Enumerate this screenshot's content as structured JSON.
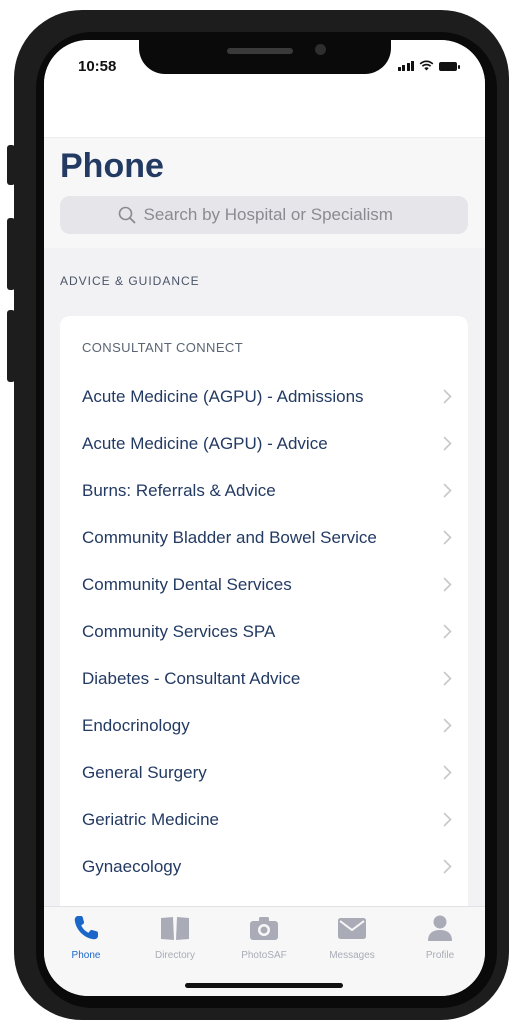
{
  "status_bar": {
    "time": "10:58"
  },
  "page": {
    "title": "Phone"
  },
  "search": {
    "placeholder": "Search by Hospital or Specialism"
  },
  "section": {
    "label": "ADVICE & GUIDANCE"
  },
  "card": {
    "heading": "CONSULTANT CONNECT",
    "items": [
      {
        "label": "Acute Medicine (AGPU) - Admissions"
      },
      {
        "label": "Acute Medicine (AGPU) - Advice"
      },
      {
        "label": "Burns: Referrals & Advice"
      },
      {
        "label": "Community Bladder and Bowel Service"
      },
      {
        "label": "Community Dental Services"
      },
      {
        "label": "Community Services SPA"
      },
      {
        "label": "Diabetes - Consultant Advice"
      },
      {
        "label": "Endocrinology"
      },
      {
        "label": "General Surgery"
      },
      {
        "label": "Geriatric Medicine"
      },
      {
        "label": "Gynaecology"
      }
    ]
  },
  "tabbar": {
    "tabs": [
      {
        "label": "Phone",
        "icon": "phone-icon",
        "active": true
      },
      {
        "label": "Directory",
        "icon": "book-icon",
        "active": false
      },
      {
        "label": "PhotoSAF",
        "icon": "camera-icon",
        "active": false
      },
      {
        "label": "Messages",
        "icon": "envelope-icon",
        "active": false
      },
      {
        "label": "Profile",
        "icon": "person-icon",
        "active": false
      }
    ]
  },
  "colors": {
    "title": "#233a63",
    "accent": "#1a67c9",
    "inactive_tab": "#a9acb6",
    "background": "#f2f2f4"
  }
}
